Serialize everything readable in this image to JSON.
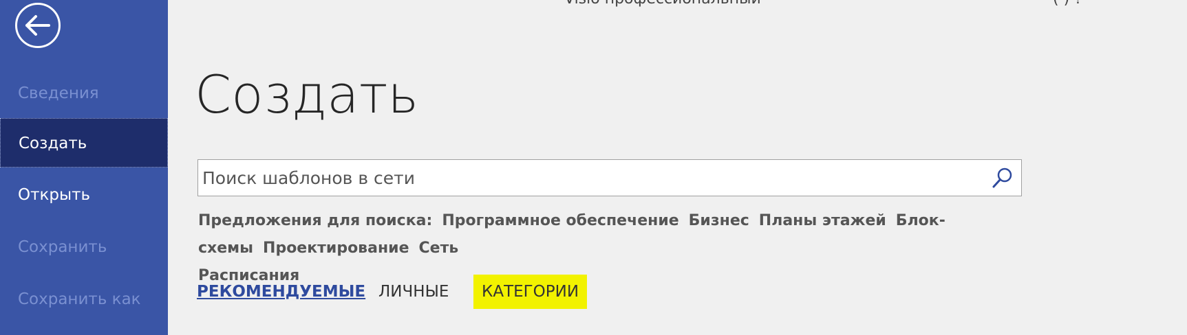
{
  "window": {
    "title": "Visio профессиональный",
    "title_extra": "(        )   ?"
  },
  "sidebar": {
    "back_icon": "back-arrow-icon",
    "colors": {
      "background": "#3a55a6",
      "active": "#1e2d6b",
      "disabled_text": "#7a90d1"
    },
    "items": [
      {
        "label": "Сведения",
        "state": "disabled"
      },
      {
        "label": "Создать",
        "state": "active"
      },
      {
        "label": "Открыть",
        "state": "normal"
      },
      {
        "label": "Сохранить",
        "state": "disabled"
      },
      {
        "label": "Сохранить как",
        "state": "disabled"
      }
    ]
  },
  "main": {
    "title": "Создать",
    "search": {
      "placeholder": "Поиск шаблонов в сети",
      "value": "",
      "icon": "search-icon"
    },
    "suggestions": {
      "label": "Предложения для поиска:",
      "items": [
        "Программное обеспечение",
        "Бизнес",
        "Планы этажей",
        "Блок-схемы",
        "Проектирование",
        "Сеть",
        "Расписания"
      ]
    },
    "tabs": [
      {
        "label": "РЕКОМЕНДУЕМЫЕ",
        "state": "selected"
      },
      {
        "label": "ЛИЧНЫЕ",
        "state": "normal"
      },
      {
        "label": "КАТЕГОРИИ",
        "state": "highlighted"
      }
    ],
    "colors": {
      "accent": "#2e4a9e",
      "highlight": "#f2f200"
    }
  }
}
